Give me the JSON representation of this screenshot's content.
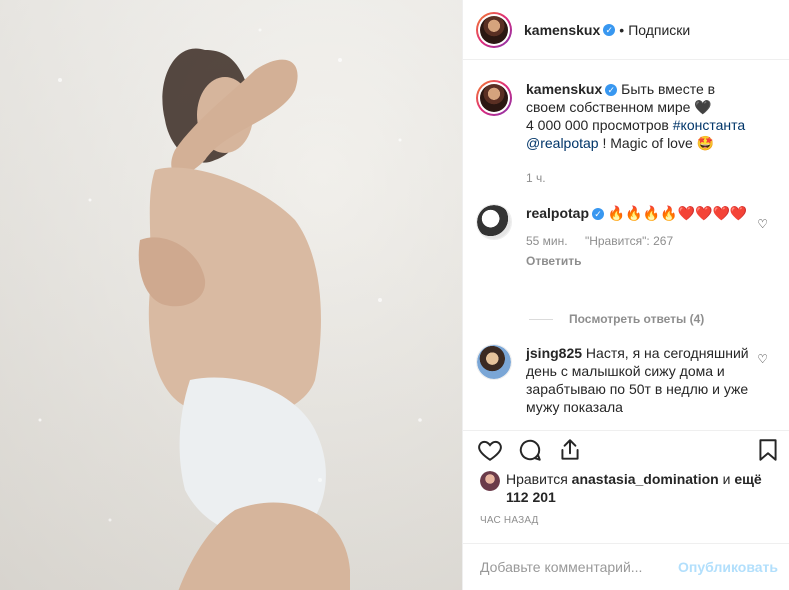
{
  "header": {
    "username": "kamenskux",
    "separator": "•",
    "follow_label": "Подписки"
  },
  "caption": {
    "username": "kamenskux",
    "text_line1": "Быть вместе в своем собственном мире 🖤",
    "text_line2": "4 000 000 просмотров",
    "hashtag": "#константа",
    "mention": "@realpotap",
    "text_after": "! Magic of love 🤩",
    "time": "1 ч."
  },
  "comments": [
    {
      "username": "realpotap",
      "text": "🔥🔥🔥🔥❤️❤️❤️❤️",
      "time": "55 мин.",
      "likes": "\"Нравится\": 267",
      "reply_label": "Ответить",
      "view_replies": "Посмотреть ответы (4)"
    },
    {
      "username": "jsing825",
      "text": "Настя, я на сегодняшний день с малышкой сижу дома и зарабтываю по 50т в недлю и уже мужу показала"
    }
  ],
  "likes": {
    "prefix": "Нравится",
    "user": "anastasia_domination",
    "suffix_and": "и",
    "others": "ещё 112 201"
  },
  "time_ago": "ЧАС НАЗАД",
  "add_comment": {
    "placeholder": "Добавьте комментарий...",
    "publish_label": "Опубликовать"
  },
  "icons": {
    "verified": "verified-badge-icon",
    "like": "heart-icon",
    "comment": "comment-icon",
    "share": "share-icon",
    "save": "bookmark-icon"
  },
  "colors": {
    "verified": "#3897f0",
    "link": "#003569",
    "muted": "#8e8e8e",
    "publish_disabled": "#b2dffc"
  }
}
